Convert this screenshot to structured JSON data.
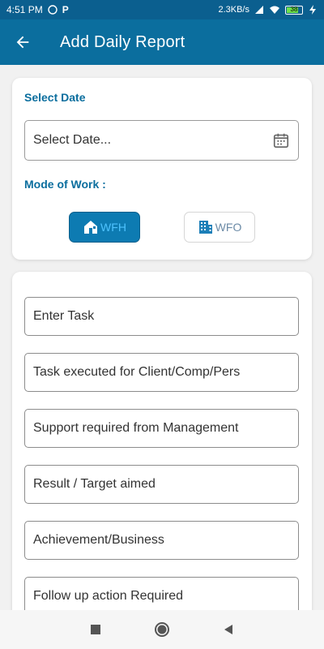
{
  "status_bar": {
    "time": "4:51 PM",
    "speed": "2.3KB/s",
    "battery": "38"
  },
  "app_bar": {
    "title": "Add Daily Report",
    "back_icon": "arrow-left-icon"
  },
  "date_section": {
    "label": "Select Date",
    "placeholder": "Select Date...",
    "icon": "calendar-icon"
  },
  "mode_section": {
    "label": "Mode of Work :",
    "options": [
      {
        "label": "WFH",
        "icon": "home-icon",
        "selected": true
      },
      {
        "label": "WFO",
        "icon": "office-building-icon",
        "selected": false
      }
    ]
  },
  "fields": [
    {
      "placeholder": "Enter Task"
    },
    {
      "placeholder": "Task executed for Client/Comp/Pers"
    },
    {
      "placeholder": "Support required from Management"
    },
    {
      "placeholder": "Result / Target aimed"
    },
    {
      "placeholder": "Achievement/Business"
    },
    {
      "placeholder": "Follow up action Required"
    }
  ],
  "colors": {
    "primary": "#0b6e9e",
    "status_bar": "#0b5f8f",
    "selected_button": "#0d7bb2"
  }
}
